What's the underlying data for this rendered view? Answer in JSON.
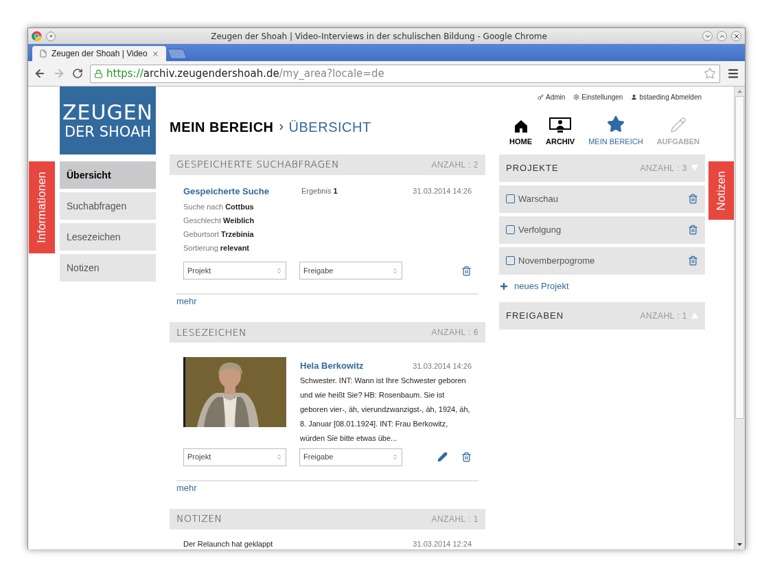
{
  "window": {
    "title": "Zeugen der Shoah | Video-Interviews in der schulischen Bildung - Google Chrome"
  },
  "tabs": [
    {
      "label": "Zeugen der Shoah | Video",
      "selected": true
    }
  ],
  "address_bar": {
    "scheme": "https://",
    "host": "archiv.zeugendershoah.de",
    "path": "/my_area?locale=de"
  },
  "logo": {
    "lines": [
      "ZEUGEN",
      "DER SHOAH"
    ]
  },
  "side_tabs": {
    "left": "Informationen",
    "right": "Notizen"
  },
  "sidebar": {
    "items": [
      {
        "label": "Übersicht",
        "selected": true
      },
      {
        "label": "Suchabfragen",
        "selected": false
      },
      {
        "label": "Lesezeichen",
        "selected": false
      },
      {
        "label": "Notizen",
        "selected": false
      }
    ]
  },
  "user_links": [
    {
      "label": "Admin",
      "kind": "key"
    },
    {
      "label": "Einstellungen",
      "kind": "gear"
    },
    {
      "label": "bstaeding Abmelden",
      "kind": "user"
    }
  ],
  "breadcrumb": [
    "MEIN BEREICH",
    "ÜBERSICHT"
  ],
  "nav": [
    {
      "label": "HOME",
      "kind": "home",
      "selected": false,
      "disabled": false
    },
    {
      "label": "ARCHIV",
      "kind": "archive",
      "selected": false,
      "disabled": false
    },
    {
      "label": "MEIN BEREICH",
      "kind": "star",
      "selected": true,
      "disabled": false
    },
    {
      "label": "AUFGABEN",
      "kind": "pencil",
      "selected": false,
      "disabled": true
    }
  ],
  "saved_searches": {
    "title": "GESPEICHERTE SUCHABFRAGEN",
    "count": "ANZAHL : 2",
    "more": "mehr",
    "items": [
      {
        "title": "Gespeicherte Suche",
        "result_label": "Ergebnis",
        "result": "1",
        "date": "31.03.2014 14:26",
        "project_select": "Projekt",
        "share_select": "Freigabe",
        "params": [
          {
            "label": "Suche nach",
            "value": "Cottbus"
          },
          {
            "label": "Geschlecht",
            "value": "Weiblich"
          },
          {
            "label": "Geburtsort",
            "value": "Trzebinia"
          },
          {
            "label": "Sortierung",
            "value": "relevant"
          }
        ]
      }
    ]
  },
  "bookmarks": {
    "title": "LESEZEICHEN",
    "count": "ANZAHL : 6",
    "more": "mehr",
    "items": [
      {
        "name": "Hela Berkowitz",
        "date": "31.03.2014 14:26",
        "excerpt": "Schwester. INT: Wann ist Ihre Schwester geboren und wie heißt Sie? HB: Rosenbaum. Sie ist geboren vier-, äh, vierundzwanzigst-, äh, 1924, äh, 8. Januar [08.01.1924]. INT: Frau Berkowitz, würden Sie bitte etwas übe...",
        "project_select": "Projekt",
        "share_select": "Freigabe"
      }
    ]
  },
  "notes": {
    "title": "NOTIZEN",
    "count": "ANZAHL : 1",
    "items": [
      {
        "text": "Der Relaunch hat geklappt",
        "date": "31.03.2014 12:24"
      }
    ]
  },
  "projects": {
    "title": "PROJEKTE",
    "count": "ANZAHL : 3",
    "expanded": true,
    "add": "neues Projekt",
    "items": [
      {
        "name": "Warschau",
        "checked": false
      },
      {
        "name": "Verfolgung",
        "checked": false
      },
      {
        "name": "Novemberpogrome",
        "checked": false
      }
    ]
  },
  "shares": {
    "title": "FREIGABEN",
    "count": "ANZAHL : 1",
    "expanded": false
  }
}
